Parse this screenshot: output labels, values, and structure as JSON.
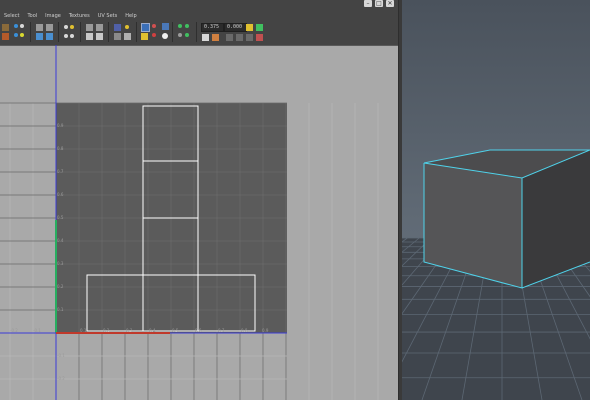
{
  "window": {
    "controls": [
      "–",
      "□",
      "✕"
    ]
  },
  "menus": [
    "Select",
    "Tool",
    "Image",
    "Textures",
    "UV Sets",
    "Help"
  ],
  "toolbar": {
    "field_u": "0.375",
    "field_v": "0.000"
  },
  "grid_labels": {
    "v_axis": [
      "0.9",
      "0.8",
      "0.7",
      "0.6",
      "0.5",
      "0.4",
      "0.3",
      "0.2",
      "0.1"
    ],
    "u_axis": [
      "-0.2",
      "-0.1",
      "0.1",
      "0.2",
      "0.3",
      "0.4",
      "0.5",
      "0.6",
      "0.7",
      "0.8",
      "0.9",
      "1.0"
    ],
    "neg_v": [
      "-0.1",
      "-0.2"
    ]
  },
  "colors": {
    "uv_tile": "#5b5b5b",
    "uv_border": "#ffffff",
    "u_axis": "#c0392b",
    "v_axis": "#27ae60",
    "tile_edge": "#3b3bd6",
    "mesh_wire": "#4fd2ea",
    "floor_grid": "#5c6773"
  },
  "icons": [
    "select-icon",
    "move-icon",
    "rotate-icon",
    "scale-icon",
    "uv-shell-icon",
    "flip-icon",
    "grid-icon",
    "texture-icon",
    "snap-icon",
    "checker-icon",
    "shade-icon",
    "refresh-icon"
  ]
}
